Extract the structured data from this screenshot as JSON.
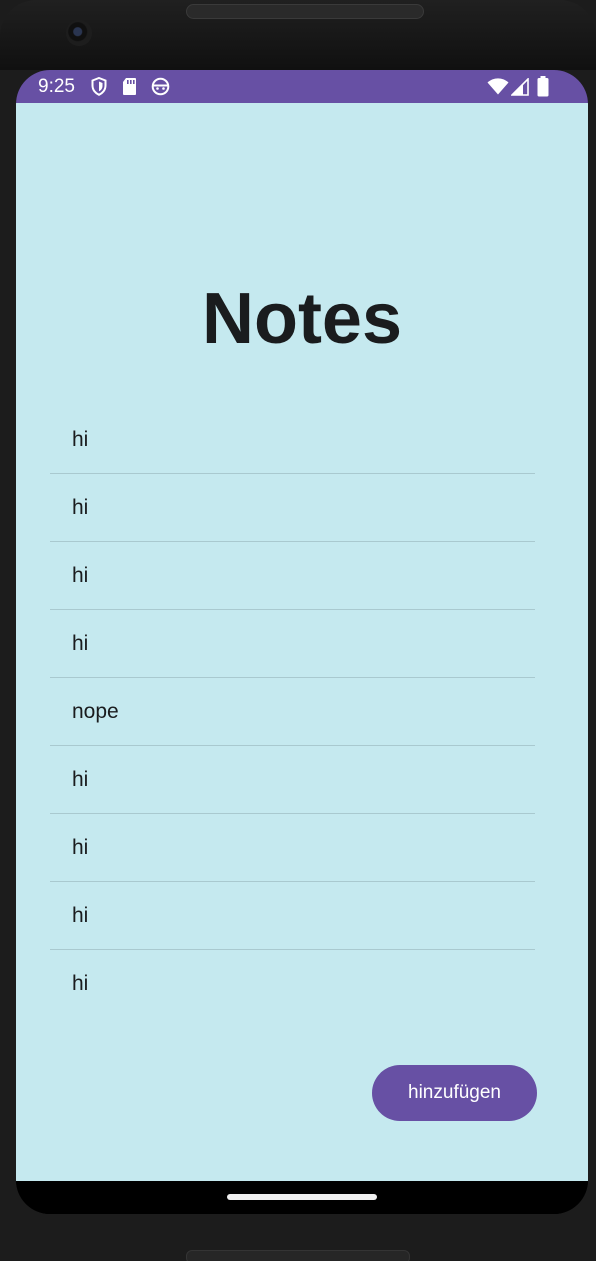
{
  "status_bar": {
    "time": "9:25",
    "left_icons": [
      "shield-icon",
      "sd-card-icon",
      "android-face-icon"
    ],
    "right_icons": [
      "wifi-icon",
      "cell-signal-icon",
      "battery-icon"
    ],
    "background": "#6750a4"
  },
  "app": {
    "title": "Notes",
    "background": "#c5e9ef",
    "notes": [
      {
        "text": "hi"
      },
      {
        "text": "hi"
      },
      {
        "text": "hi"
      },
      {
        "text": "hi"
      },
      {
        "text": "nope"
      },
      {
        "text": "hi"
      },
      {
        "text": "hi"
      },
      {
        "text": "hi"
      },
      {
        "text": "hi"
      }
    ],
    "add_button_label": "hinzufügen",
    "accent": "#6750a4"
  }
}
